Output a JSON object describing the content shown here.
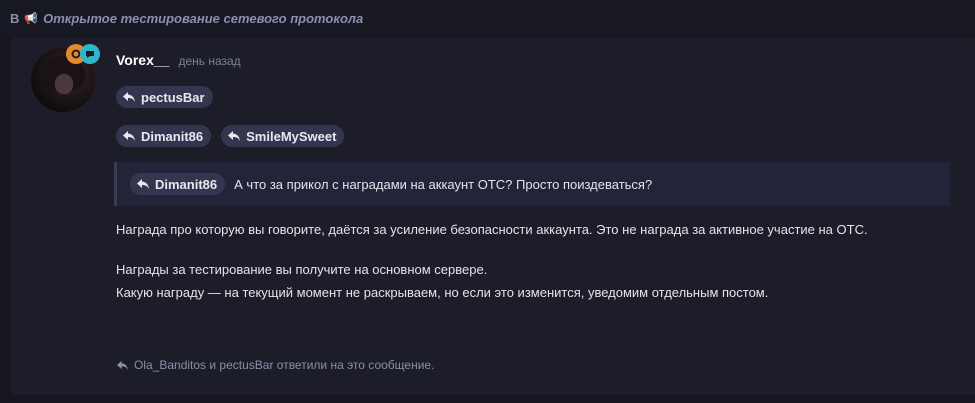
{
  "breadcrumb": {
    "prefix": "В",
    "emoji": "📢",
    "title": "Открытое тестирование сетевого протокола"
  },
  "post": {
    "author": "Vorex__",
    "time": "день назад",
    "mentions_row1": [
      {
        "label": "pectusBar"
      }
    ],
    "mentions_row2": [
      {
        "label": "Dimanit86"
      },
      {
        "label": "SmileMySweet"
      }
    ],
    "quote": {
      "author": "Dimanit86",
      "text": "А что за прикол с наградами на аккаунт ОТС? Просто поиздеваться?"
    },
    "paragraphs": [
      [
        "Награда про которую вы говорите, даётся за усиление безопасности аккаунта. Это не награда за активное участие на ОТС."
      ],
      [
        "Награды за тестирование вы получите на основном сервере.",
        "Какую награду — на текущий момент не раскрываем, но если это изменится, уведомим отдельным постом."
      ]
    ],
    "replies_text": "Ola_Banditos и pectusBar ответили на это сообщение."
  },
  "icons": {
    "reply": "reply-arrow-icon",
    "badge_1": "orange-role-badge-icon",
    "badge_2": "teal-chat-badge-icon"
  },
  "colors": {
    "background": "#15161f",
    "panel": "#1c1d29",
    "chip": "#343650",
    "quote_bg": "#23243a",
    "breadcrumb_title": "#8a8fb3",
    "badge_orange": "#e58a2b",
    "badge_teal": "#2fb6c9"
  }
}
